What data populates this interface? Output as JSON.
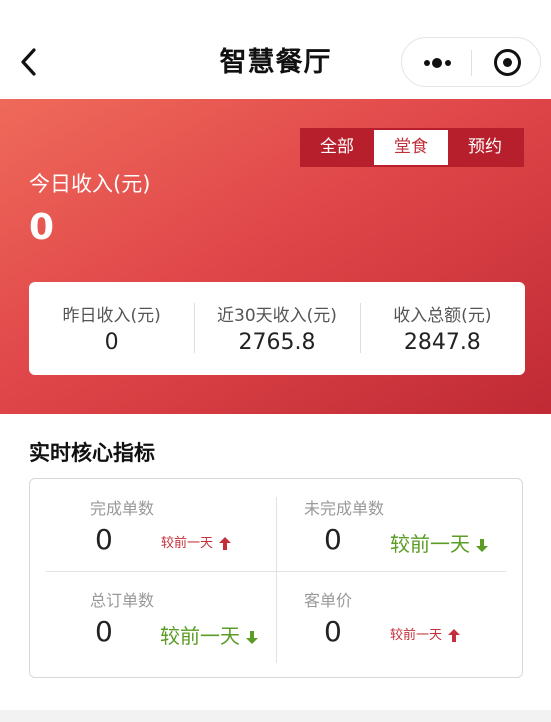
{
  "nav": {
    "title": "智慧餐厅"
  },
  "icons": {
    "back": "chevron-left-icon",
    "more": "more-dots-icon",
    "close": "target-circle-icon",
    "up": "arrow-up-icon",
    "down": "arrow-down-icon"
  },
  "colors": {
    "brand_red": "#d9383f",
    "segment_bg": "#b81f2c",
    "up_red": "#c43039",
    "down_green": "#5a9c24"
  },
  "filter": {
    "tabs": [
      "全部",
      "堂食",
      "预约"
    ],
    "active": "堂食"
  },
  "income": {
    "label": "今日收入(元)",
    "value": "0"
  },
  "stats": [
    {
      "label": "昨日收入(元)",
      "value": "0"
    },
    {
      "label": "近30天收入(元)",
      "value": "2765.8"
    },
    {
      "label": "收入总额(元)",
      "value": "2847.8"
    }
  ],
  "section": {
    "title": "实时核心指标"
  },
  "metrics": [
    {
      "label": "完成单数",
      "value": "0",
      "compare": "较前一天",
      "trend": "up"
    },
    {
      "label": "未完成单数",
      "value": "0",
      "compare": "较前一天",
      "trend": "down"
    },
    {
      "label": "总订单数",
      "value": "0",
      "compare": "较前一天",
      "trend": "down"
    },
    {
      "label": "客单价",
      "value": "0",
      "compare": "较前一天",
      "trend": "up"
    }
  ]
}
